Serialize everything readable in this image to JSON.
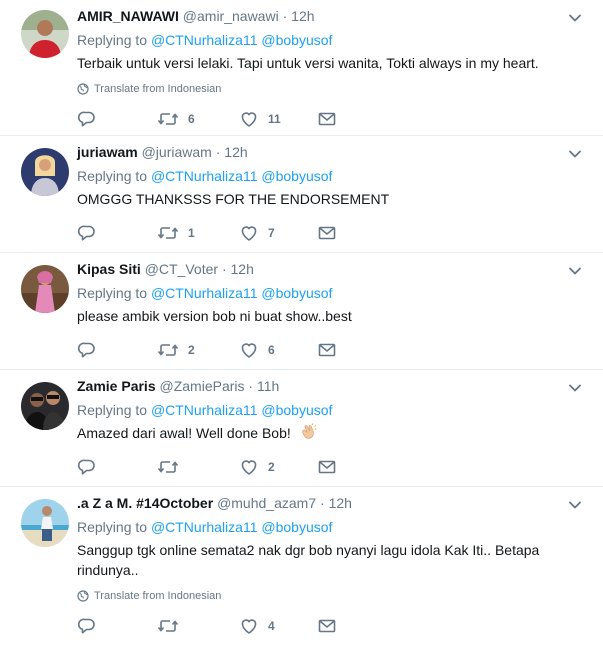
{
  "replying_label": "Replying to",
  "translate_label": "Translate from Indonesian",
  "icons": {
    "reply": "reply-icon",
    "retweet": "retweet-icon",
    "like": "heart-icon",
    "dm": "envelope-icon",
    "caret": "chevron-down-icon",
    "globe": "globe-icon"
  },
  "colors": {
    "link": "#1da1f2",
    "muted": "#657786",
    "text": "#14171a",
    "divider": "#e6ecf0"
  },
  "tweets": [
    {
      "name": "AMIR_NAWAWI",
      "handle": "@amir_nawawi",
      "time": "12h",
      "mention1": "@CTNurhaliza11",
      "mention2": "@bobyusof",
      "text": "Terbaik untuk versi lelaki. Tapi untuk versi wanita, Tokti always in my heart.",
      "retweets": "6",
      "likes": "11"
    },
    {
      "name": "juriawam",
      "handle": "@juriawam",
      "time": "12h",
      "mention1": "@CTNurhaliza11",
      "mention2": "@bobyusof",
      "text": "OMGGG THANKSSS FOR THE ENDORSEMENT",
      "retweets": "1",
      "likes": "7"
    },
    {
      "name": "Kipas Siti",
      "handle": "@CT_Voter",
      "time": "12h",
      "mention1": "@CTNurhaliza11",
      "mention2": "@bobyusof",
      "text": "please ambik version bob ni buat show..best",
      "retweets": "2",
      "likes": "6"
    },
    {
      "name": "Zamie Paris",
      "handle": "@ZamieParis",
      "time": "11h",
      "mention1": "@CTNurhaliza11",
      "mention2": "@bobyusof",
      "text": "Amazed dari awal! Well done Bob!",
      "emoji": "clapping-hands",
      "retweets": "",
      "likes": "2"
    },
    {
      "name": ".a Z a M. #14October",
      "handle": "@muhd_azam7",
      "time": "12h",
      "mention1": "@CTNurhaliza11",
      "mention2": "@bobyusof",
      "text": "Sanggup tgk online semata2 nak dgr bob nyanyi lagu idola Kak Iti.. Betapa rindunya..",
      "retweets": "",
      "likes": "4"
    }
  ]
}
